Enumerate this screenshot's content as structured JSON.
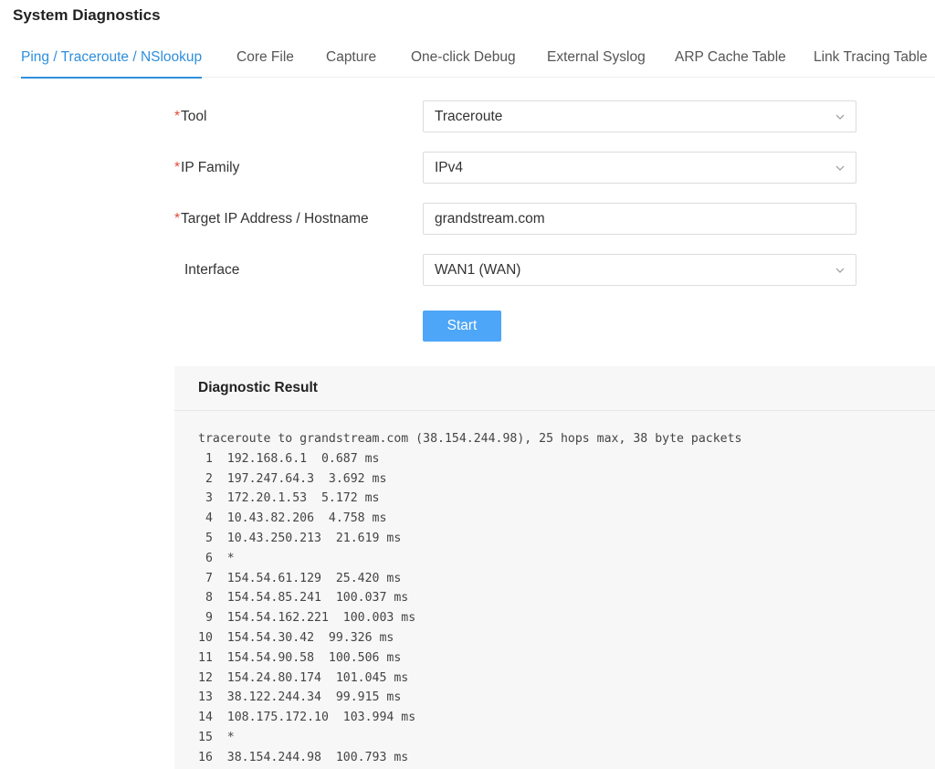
{
  "page": {
    "title": "System Diagnostics"
  },
  "tabs": [
    {
      "label": "Ping / Traceroute / NSlookup",
      "active": true
    },
    {
      "label": "Core File",
      "active": false
    },
    {
      "label": "Capture",
      "active": false
    },
    {
      "label": "One-click Debug",
      "active": false
    },
    {
      "label": "External Syslog",
      "active": false
    },
    {
      "label": "ARP Cache Table",
      "active": false
    },
    {
      "label": "Link Tracing Table",
      "active": false
    }
  ],
  "form": {
    "required_mark": "*",
    "tool": {
      "label": "Tool",
      "value": "Traceroute"
    },
    "ip_family": {
      "label": "IP Family",
      "value": "IPv4"
    },
    "target": {
      "label": "Target IP Address / Hostname",
      "value": "grandstream.com"
    },
    "interface": {
      "label": "Interface",
      "value": "WAN1 (WAN)"
    },
    "start_label": "Start"
  },
  "result": {
    "title": "Diagnostic Result",
    "lines": [
      "traceroute to grandstream.com (38.154.244.98), 25 hops max, 38 byte packets",
      " 1  192.168.6.1  0.687 ms",
      " 2  197.247.64.3  3.692 ms",
      " 3  172.20.1.53  5.172 ms",
      " 4  10.43.82.206  4.758 ms",
      " 5  10.43.250.213  21.619 ms",
      " 6  *",
      " 7  154.54.61.129  25.420 ms",
      " 8  154.54.85.241  100.037 ms",
      " 9  154.54.162.221  100.003 ms",
      "10  154.54.30.42  99.326 ms",
      "11  154.54.90.58  100.506 ms",
      "12  154.24.80.174  101.045 ms",
      "13  38.122.244.34  99.915 ms",
      "14  108.175.172.10  103.994 ms",
      "15  *",
      "16  38.154.244.98  100.793 ms"
    ]
  },
  "colors": {
    "accent": "#2f8fdc",
    "button": "#4da6f7",
    "required": "#e14b3b",
    "panel_bg": "#f7f7f7"
  },
  "icons": {
    "select_arrow": "chevron-down-icon"
  }
}
